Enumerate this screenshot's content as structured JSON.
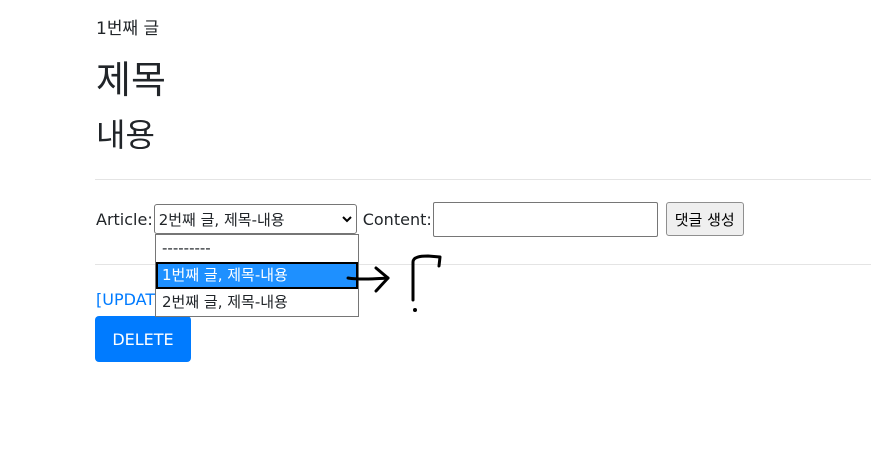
{
  "article": {
    "id_label": "1번째 글",
    "title": "제목",
    "content": "내용"
  },
  "comment_form": {
    "article_label": "Article:",
    "selected_value": "2번째 글, 제목-내용",
    "content_label": "Content:",
    "content_value": "",
    "submit_label": "댓글 생성",
    "options": [
      "---------",
      "1번째 글, 제목-내용",
      "2번째 글, 제목-내용"
    ],
    "highlighted_option": "1번째 글, 제목-내용"
  },
  "actions": {
    "update_label": "[UPDATE]",
    "delete_label": "DELETE"
  },
  "colors": {
    "primary": "#007bff",
    "option_highlight": "#1e90ff"
  }
}
